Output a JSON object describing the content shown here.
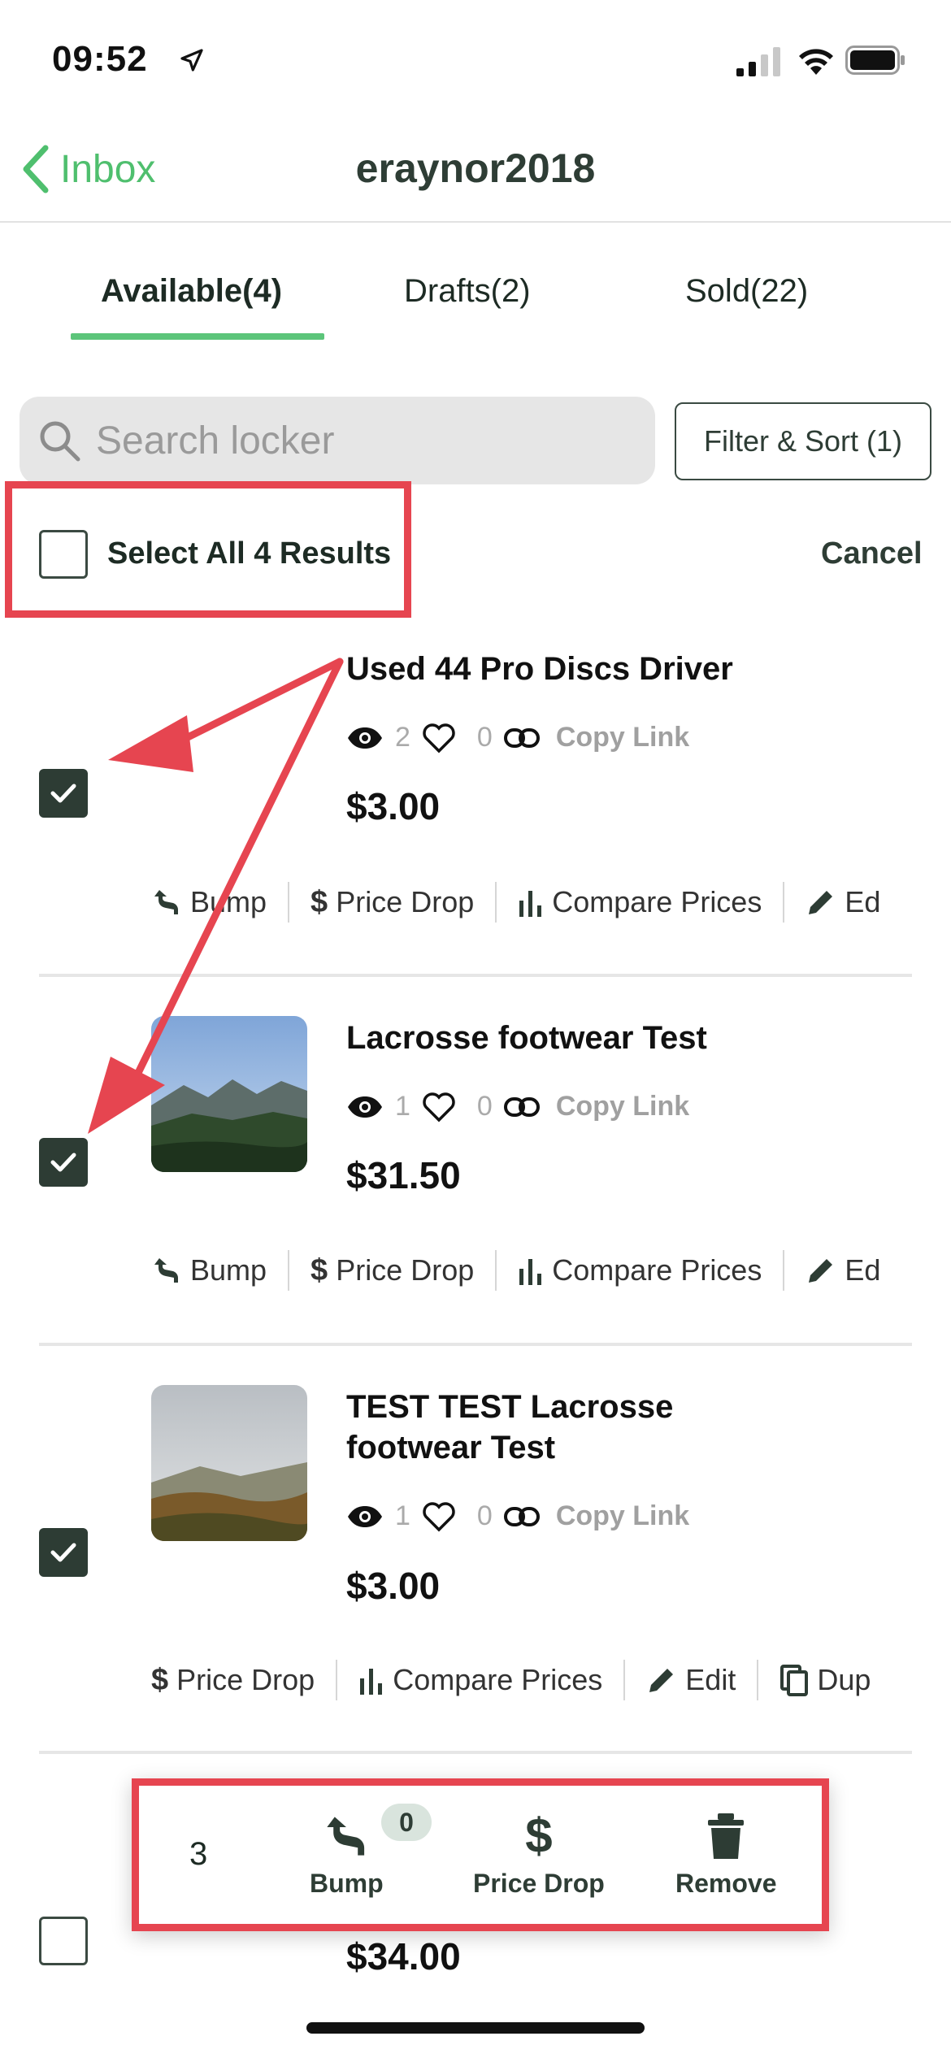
{
  "status": {
    "time": "09:52"
  },
  "nav": {
    "back_label": "Inbox",
    "title": "eraynor2018"
  },
  "tabs": [
    {
      "label": "Available(4)",
      "active": true
    },
    {
      "label": "Drafts(2)",
      "active": false
    },
    {
      "label": "Sold(22)",
      "active": false
    }
  ],
  "search": {
    "placeholder": "Search locker"
  },
  "filter_label": "Filter & Sort (1)",
  "select_all_label": "Select All 4 Results",
  "cancel_label": "Cancel",
  "items": [
    {
      "title": "Used 44 Pro Discs Driver",
      "views": "2",
      "likes": "0",
      "copy_link": "Copy Link",
      "price": "$3.00",
      "checked": true,
      "actions": [
        "Bump",
        "Price Drop",
        "Compare Prices",
        "Ed"
      ]
    },
    {
      "title": "Lacrosse footwear Test",
      "views": "1",
      "likes": "0",
      "copy_link": "Copy Link",
      "price": "$31.50",
      "checked": true,
      "actions": [
        "Bump",
        "Price Drop",
        "Compare Prices",
        "Ed"
      ]
    },
    {
      "title_line1": "TEST TEST Lacrosse",
      "title_line2": "footwear Test",
      "views": "1",
      "likes": "0",
      "copy_link": "Copy Link",
      "price": "$3.00",
      "checked": true,
      "actions": [
        "Price Drop",
        "Compare Prices",
        "Edit",
        "Dup"
      ]
    },
    {
      "price": "$34.00",
      "checked": false
    }
  ],
  "bulk": {
    "count": "3",
    "bump_badge": "0",
    "bump_label": "Bump",
    "price_drop_label": "Price Drop",
    "remove_label": "Remove"
  },
  "colors": {
    "accent": "#5cc57a",
    "annotation": "#e64550",
    "checkbox": "#2d3c34"
  }
}
